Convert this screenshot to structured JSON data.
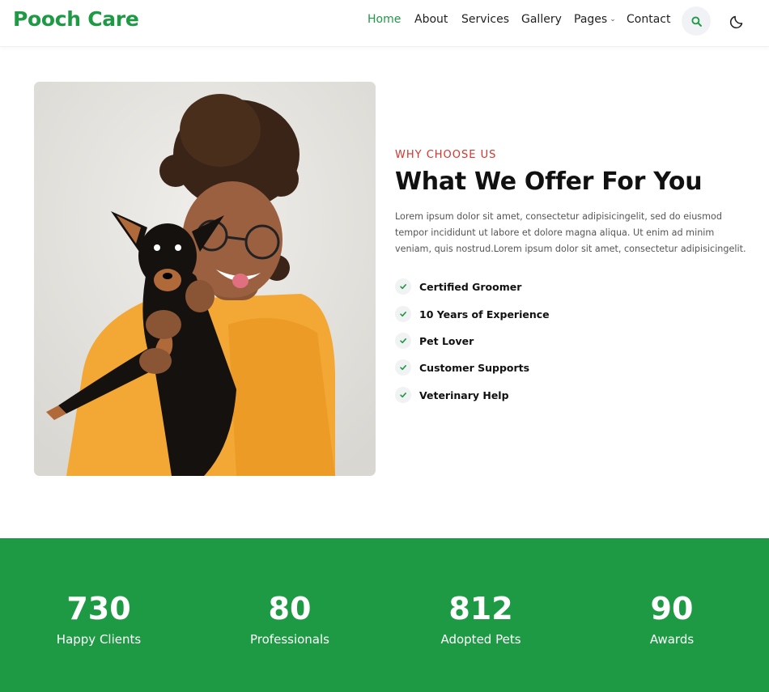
{
  "header": {
    "logo": "Pooch Care",
    "nav": [
      {
        "label": "Home",
        "active": true
      },
      {
        "label": "About",
        "active": false
      },
      {
        "label": "Services",
        "active": false
      },
      {
        "label": "Gallery",
        "active": false
      },
      {
        "label": "Pages",
        "active": false,
        "has_dropdown": true
      },
      {
        "label": "Contact",
        "active": false
      }
    ],
    "search_icon": "search-icon",
    "theme_icon": "moon-icon"
  },
  "about": {
    "image_alt": "woman holding a small black and tan dog",
    "eyebrow": "WHY CHOOSE US",
    "title": "What We Offer For You",
    "paragraph": "Lorem ipsum dolor sit amet, consectetur adipisicingelit, sed do eiusmod tempor incididunt ut labore et dolore magna aliqua. Ut enim ad minim veniam, quis nostrud.Lorem ipsum dolor sit amet, consectetur adipisicingelit.",
    "features": [
      "Certified Groomer",
      "10 Years of Experience",
      "Pet Lover",
      "Customer Supports",
      "Veterinary Help"
    ]
  },
  "stats": [
    {
      "value": "730",
      "label": "Happy Clients"
    },
    {
      "value": "80",
      "label": "Professionals"
    },
    {
      "value": "812",
      "label": "Adopted Pets"
    },
    {
      "value": "90",
      "label": "Awards"
    }
  ],
  "colors": {
    "brand_green": "#1e9a45",
    "eyebrow_red": "#d8322c",
    "text_dark": "#111111",
    "text_muted": "#555555"
  }
}
